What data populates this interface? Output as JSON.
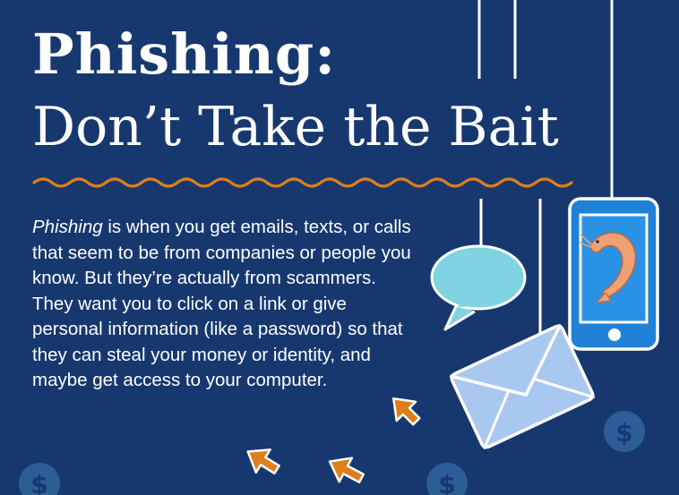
{
  "title": {
    "line1": "Phishing:",
    "line2": "Don’t Take the Bait"
  },
  "body": {
    "lead_term": "Phishing",
    "text": " is when you get emails, texts, or calls that seem to be from companies or people you know. But they’re actually from scammers. They want you to click on a link or give personal information (like a password) so that they can steal your money or identity, and maybe get access to your computer."
  },
  "icons": [
    "speech-bubble-icon",
    "envelope-icon",
    "smartphone-icon",
    "shrimp-icon",
    "dollar-coin-icon",
    "cursor-arrow-icon"
  ],
  "colors": {
    "background": "#17386f",
    "accent_orange": "#e07e1b",
    "bubble_cyan": "#7fd3e3",
    "envelope_blue": "#a9c8ef",
    "phone_blue": "#1f82d6",
    "coin_blue": "#2d5d97"
  }
}
